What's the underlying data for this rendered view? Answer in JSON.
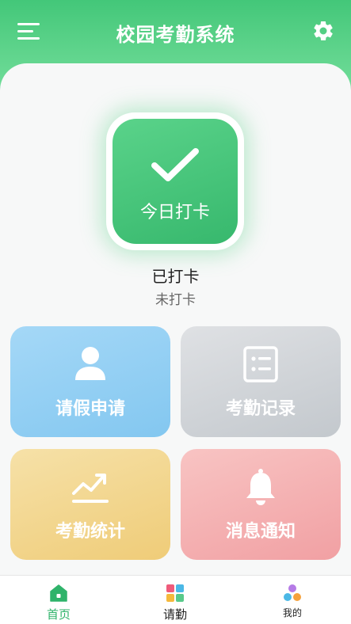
{
  "app": {
    "title": "校园考勤系统"
  },
  "checkin": {
    "button_label": "今日打卡",
    "status": "已打卡",
    "sub_status": "未打卡"
  },
  "tiles": [
    {
      "label": "请假申请",
      "icon": "user-icon"
    },
    {
      "label": "考勤记录",
      "icon": "list-icon"
    },
    {
      "label": "考勤统计",
      "icon": "trend-chart-icon"
    },
    {
      "label": "消息通知",
      "icon": "bell-icon"
    }
  ],
  "tabbar": [
    {
      "label": "首页",
      "icon": "home-icon",
      "active": true
    },
    {
      "label": "请勤",
      "icon": "grid-icon",
      "active": false
    },
    {
      "label": "我的",
      "icon": "circles-icon",
      "active": false
    }
  ],
  "colors": {
    "brand": "#3cc675",
    "leave_tile": "#8ccbf2",
    "record_tile": "#ccd0d4",
    "stats_tile": "#f2d38a",
    "message_tile": "#f4abad",
    "tab_active": "#2fb36a"
  }
}
